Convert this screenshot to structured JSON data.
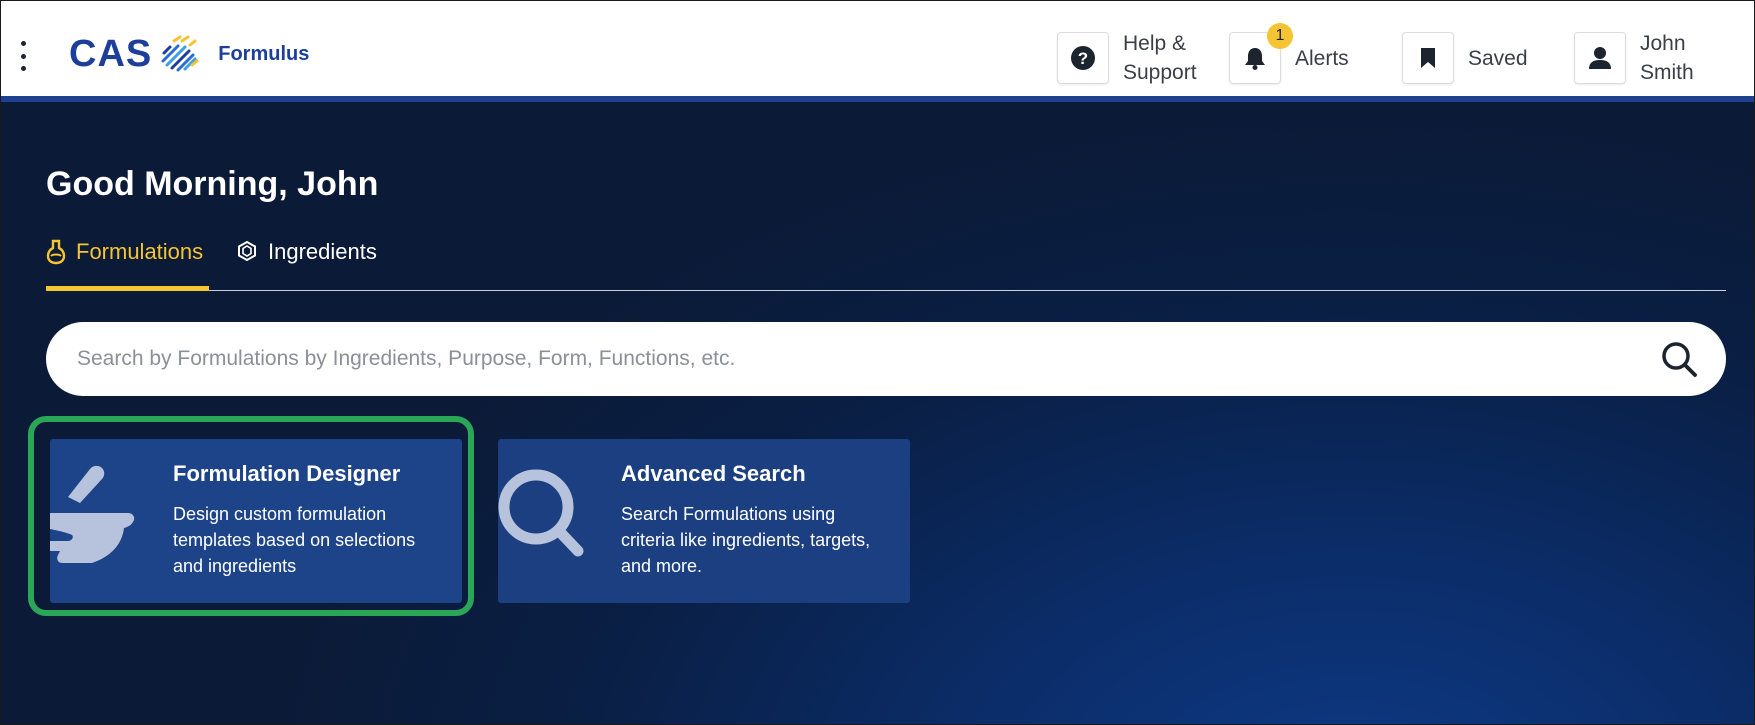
{
  "header": {
    "logo_text": "CAS",
    "product_name": "Formulus",
    "help_label": "Help &\nSupport",
    "alerts_label": "Alerts",
    "alerts_count": "1",
    "saved_label": "Saved",
    "user_label": "John\nSmith"
  },
  "main": {
    "greeting": "Good Morning, John",
    "tabs": [
      {
        "label": "Formulations",
        "icon": "flask-icon",
        "active": true
      },
      {
        "label": "Ingredients",
        "icon": "hexagon-icon",
        "active": false
      }
    ],
    "search": {
      "placeholder": "Search by Formulations by Ingredients, Purpose, Form, Functions, etc."
    },
    "cards": [
      {
        "title": "Formulation Designer",
        "description": "Design custom formulation templates based on selections and ingredients",
        "icon": "mortar-pestle-icon"
      },
      {
        "title": "Advanced Search",
        "description": "Search Formulations using criteria like ingredients, targets, and more.",
        "icon": "magnifier-icon"
      }
    ]
  },
  "colors": {
    "brand": "#1d3f9b",
    "accent": "#f4c433",
    "highlight": "#2aa657",
    "card": "#1d4389"
  }
}
